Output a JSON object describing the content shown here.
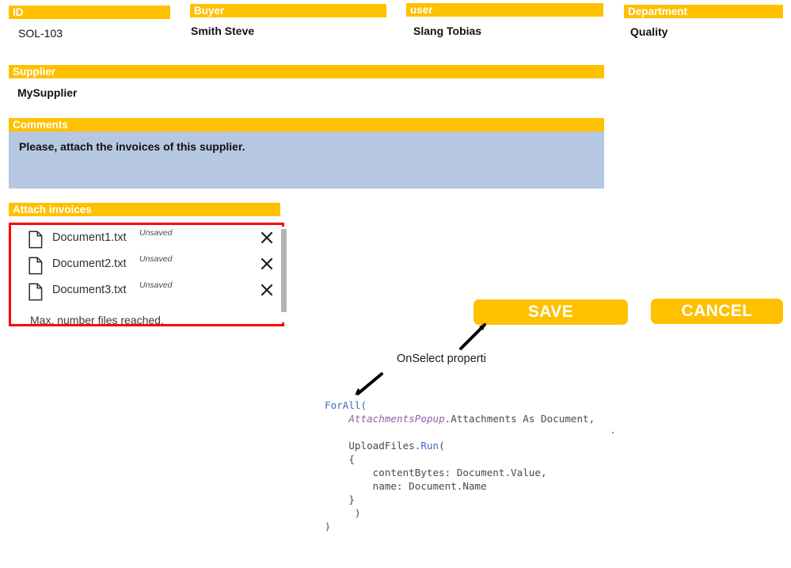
{
  "fields": [
    {
      "label": "ID",
      "value": "SOL-103",
      "bold": false
    },
    {
      "label": "Buyer",
      "value": "Smith Steve",
      "bold": true
    },
    {
      "label": "user",
      "value": "Slang Tobias",
      "bold": true
    },
    {
      "label": "Department",
      "value": "Quality",
      "bold": true
    },
    {
      "label": "Supplier",
      "value": "MySupplier",
      "bold": true
    }
  ],
  "comments": {
    "label": "Comments",
    "text": "Please, attach the invoices of this supplier."
  },
  "attachments": {
    "label": "Attach invoices",
    "items": [
      {
        "name": "Document1.txt",
        "status": "Unsaved",
        "icon": "document-icon",
        "remove_icon": "close-icon"
      },
      {
        "name": "Document2.txt",
        "status": "Unsaved",
        "icon": "document-icon",
        "remove_icon": "close-icon"
      },
      {
        "name": "Document3.txt",
        "status": "Unsaved",
        "icon": "document-icon",
        "remove_icon": "close-icon"
      }
    ],
    "footer_message": "Max. number files reached."
  },
  "buttons": {
    "save": "SAVE",
    "cancel": "CANCEL"
  },
  "annotation": {
    "label": "OnSelect properti"
  },
  "code": {
    "lines": [
      [
        {
          "t": "ForAll(",
          "c": "fn"
        }
      ],
      [
        {
          "t": "    ",
          "c": "plain"
        },
        {
          "t": "AttachmentsPopup",
          "c": "ident"
        },
        {
          "t": ".Attachments As Document,",
          "c": "plain"
        }
      ],
      [
        {
          "t": "",
          "c": "plain"
        }
      ],
      [
        {
          "t": "    UploadFiles.",
          "c": "plain"
        },
        {
          "t": "Run",
          "c": "fn"
        },
        {
          "t": "(",
          "c": "plain"
        }
      ],
      [
        {
          "t": "    {",
          "c": "plain"
        }
      ],
      [
        {
          "t": "        contentBytes: Document.Value,",
          "c": "plain"
        }
      ],
      [
        {
          "t": "        name: Document.Name",
          "c": "plain"
        }
      ],
      [
        {
          "t": "    }",
          "c": "plain"
        }
      ],
      [
        {
          "t": "     )",
          "c": "plain"
        }
      ],
      [
        {
          "t": ")",
          "c": "plain"
        }
      ]
    ]
  },
  "colors": {
    "accent_yellow": "#FFC000",
    "comment_blue": "#B6C7E2",
    "highlight_red": "#FF0000",
    "code_keyword": "#3A6FB5",
    "code_identifier": "#8F5FA8"
  }
}
